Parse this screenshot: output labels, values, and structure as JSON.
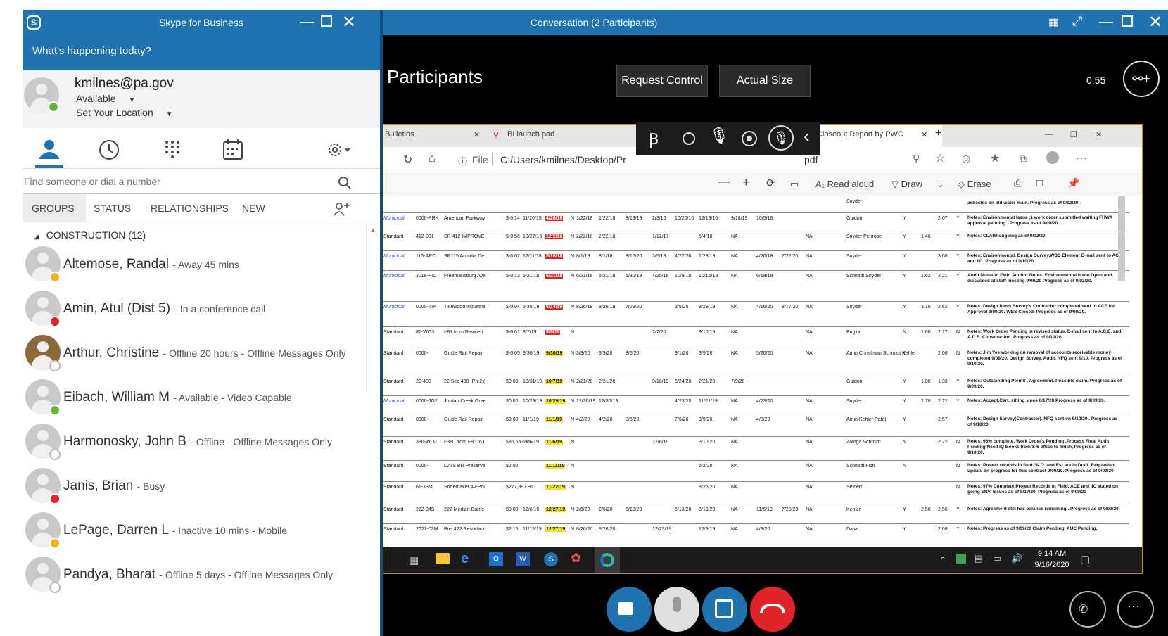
{
  "skype": {
    "title": "Skype for Business",
    "banner": "What's happening today?",
    "profile": {
      "email": "kmilnes@pa.gov",
      "status": "Available",
      "location": "Set Your Location"
    },
    "search_placeholder": "Find someone or dial a number",
    "tabs": [
      "GROUPS",
      "STATUS",
      "RELATIONSHIPS",
      "NEW"
    ],
    "group": {
      "label": "CONSTRUCTION (12)"
    },
    "contacts": [
      {
        "name": "Altemose, Randal",
        "note": "- Away 45 mins",
        "presence_color": "#f0b323"
      },
      {
        "name": "Amin, Atul (Dist 5)",
        "note": "- In a conference call",
        "presence_color": "#e0242a"
      },
      {
        "name": "Arthur, Christine",
        "note": "- Offline 20 hours - Offline Messages Only",
        "presence_color": "#ffffff"
      },
      {
        "name": "Eibach, William M",
        "note": "- Available - Video Capable",
        "presence_color": "#6bb33b"
      },
      {
        "name": "Harmonosky, John B",
        "note": "- Offline - Offline Messages Only",
        "presence_color": "#ffffff"
      },
      {
        "name": "Janis, Brian",
        "note": "- Busy",
        "presence_color": "#e0242a"
      },
      {
        "name": "LePage, Darren L",
        "note": "- Inactive 10 mins - Mobile",
        "presence_color": "#f0b323"
      },
      {
        "name": "Pandya, Bharat",
        "note": "- Offline 5 days - Offline Messages Only",
        "presence_color": "#ffffff"
      }
    ]
  },
  "conversation": {
    "title": "Conversation (2 Participants)",
    "participants_label": "Participants",
    "request_control": "Request Control",
    "actual_size": "Actual Size",
    "timer": "0:55"
  },
  "browser": {
    "tab1": "Bulletins",
    "tab2": "BI launch pad",
    "tab3": "Closeout Report by PWC",
    "file_label": "File",
    "url_start": "C:/Users/kmilnes/Desktop/Pr",
    "url_end": "pdf",
    "read_aloud": "Read aloud",
    "draw": "Draw",
    "erase": "Erase"
  },
  "pdf_rows": [
    {
      "type": "Municipal",
      "id": "0000-PRK",
      "name": "American Parkway",
      "amt": "$-0.14",
      "d1": "11/20/15",
      "flag": "4/26/16",
      "flag_color": "red",
      "n": "N",
      "c1": "1/22/18",
      "c2": "1/22/18",
      "c3": "8/13/19",
      "c4": "2/3/16",
      "c5": "10/20/16",
      "c6": "12/19/16",
      "c7": "9/18/19",
      "c8": "10/5/16",
      "c9": "",
      "c10": "",
      "person": "Guidon",
      "y1": "Y",
      "v1": "",
      "v2": "2.07",
      "y2": "Y",
      "note": "Notes: Environmental Issue ,1 work order submitted waiting FHWA approval pending . Progress as of 9/09/20."
    },
    {
      "type": "Standard",
      "id": "412-001",
      "name": "SR 412 IMPROVE",
      "amt": "$-0.56",
      "d1": "10/27/16",
      "flag": "12/2/16",
      "flag_color": "red",
      "n": "N",
      "c1": "2/22/18",
      "c2": "2/22/18",
      "c3": "",
      "c4": "1/12/17",
      "c5": "",
      "c6": "6/4/18",
      "c7": "NA",
      "c8": "",
      "c9": "",
      "c10": "NA",
      "person": "Snyder Penrose",
      "y1": "Y",
      "v1": "1.46",
      "v2": "",
      "y2": "Y",
      "note": "Notes: CLAIM ongoing as of 9/02/20."
    },
    {
      "type": "Municipal",
      "id": "115-ARC",
      "name": "SR115 Arcadia De",
      "amt": "$-0.07",
      "d1": "12/11/18",
      "flag": "5/18/18",
      "flag_color": "red",
      "n": "N",
      "c1": "8/1/18",
      "c2": "8/1/18",
      "c3": "8/16/20",
      "c4": "3/5/18",
      "c5": "4/22/20",
      "c6": "1/28/19",
      "c7": "NA",
      "c8": "4/20/18",
      "c9": "7/22/20",
      "c10": "NA",
      "person": "Snyder",
      "y1": "Y",
      "v1": "",
      "v2": "3.00",
      "y2": "Y",
      "note": "Notes: Environmental, Design Survey,WBS Element E-mail sent to ACE and IIC. Progress as of 9/10/20"
    },
    {
      "type": "Municipal",
      "id": "2018-FIC",
      "name": "Freemansburg Ave",
      "amt": "$-0.13",
      "d1": "6/21/18",
      "flag": "6/21/18",
      "flag_color": "red",
      "n": "N",
      "c1": "6/21/18",
      "c2": "6/21/18",
      "c3": "1/30/19",
      "c4": "4/25/18",
      "c5": "10/9/18",
      "c6": "10/16/18",
      "c7": "NA",
      "c8": "6/18/18",
      "c9": "",
      "c10": "NA",
      "person": "Schmidt Snyder",
      "y1": "Y",
      "v1": "1.62",
      "v2": "2.21",
      "y2": "Y",
      "note": "Audit Notes to Field Auditor Notes: Environmental Issue Open and discussed at staff meeting 9/09/20 Progress as of 9/02/20."
    },
    {
      "type": "Municipal",
      "id": "0000-TIP",
      "name": "Tidewood Industrie",
      "amt": "$-0.04",
      "d1": "5/30/19",
      "flag": "6/14/19",
      "flag_color": "red",
      "n": "N",
      "c1": "8/26/19",
      "c2": "8/26/19",
      "c3": "7/29/20",
      "c4": "",
      "c5": "3/5/20",
      "c6": "8/29/19",
      "c7": "NA",
      "c8": "4/16/20",
      "c9": "8/17/20",
      "c10": "NA",
      "person": "Snyder",
      "y1": "Y",
      "v1": "3.10",
      "v2": "2.62",
      "y2": "Y",
      "note": "Notes: Design Items Survey's Contractor completed sent to ACE for Approval 9/09/20. WBS Closed. Progress as of 9/09/20."
    },
    {
      "type": "Standard",
      "id": "81-WO3",
      "name": "I-81 from Ravine t",
      "amt": "$-0.01",
      "d1": "8/7/19",
      "flag": "8/9/19",
      "flag_color": "red",
      "n": "N",
      "c1": "",
      "c2": "",
      "c3": "",
      "c4": "2/7/20",
      "c5": "",
      "c6": "9/10/19",
      "c7": "NA",
      "c8": "",
      "c9": "",
      "c10": "NA",
      "person": "Puglia",
      "y1": "N",
      "v1": "1.60",
      "v2": "2.17",
      "y2": "N",
      "note": "Notes: Work Order Pending in revised status. E-mail sent to A.C.E. and A.D.E. Construction. Progress as of 9/10/20."
    },
    {
      "type": "Standard",
      "id": "0000-",
      "name": "Guide Rail Repair",
      "amt": "$-0.05",
      "d1": "9/30/19",
      "flag": "9/30/19",
      "flag_color": "yellow",
      "n": "N",
      "c1": "3/9/20",
      "c2": "3/9/20",
      "c3": "8/5/20",
      "c4": "",
      "c5": "9/1/20",
      "c6": "3/9/20",
      "c7": "NA",
      "c8": "5/20/20",
      "c9": "",
      "c10": "NA",
      "person": "Amin Christman Schmidt Kehler",
      "y1": "Y",
      "v1": "",
      "v2": "2.00",
      "y2": "N",
      "note": "Notes: Jim Yee working on removal of accounts receivable money completed 9/08/20. Design Survey, Audit. NFQ sent 9/10. Progress as of 9/10/20."
    },
    {
      "type": "Standard",
      "id": "22-400",
      "name": "22 Sec 400- Ph 2 (",
      "amt": "$0.00",
      "d1": "10/31/19",
      "flag": "10/7/19",
      "flag_color": "yellow",
      "n": "N",
      "c1": "2/21/20",
      "c2": "2/21/20",
      "c3": "",
      "c4": "9/18/19",
      "c5": "6/24/20",
      "c6": "2/21/20",
      "c7": "7/9/20",
      "c8": "",
      "c9": "",
      "c10": "",
      "person": "Guidon",
      "y1": "Y",
      "v1": "1.80",
      "v2": "1.33",
      "y2": "Y",
      "note": "Notes: Outstanding Permit , Agreement. Possible claim. Progress as of 9/09/20."
    },
    {
      "type": "Municipal",
      "id": "0000-JG2",
      "name": "Jordan Creek Gree",
      "amt": "$0.00",
      "d1": "10/29/19",
      "flag": "10/29/19",
      "flag_color": "yellow",
      "n": "N",
      "c1": "12/30/19",
      "c2": "12/30/19",
      "c3": "",
      "c4": "",
      "c5": "4/23/20",
      "c6": "11/21/19",
      "c7": "NA",
      "c8": "4/23/20",
      "c9": "",
      "c10": "NA",
      "person": "Snyder",
      "y1": "Y",
      "v1": "2.70",
      "v2": "2.22",
      "y2": "Y",
      "note": "Notes: Accept.Cert. sitting since 6/17/20.Progress as of 9/09/20."
    },
    {
      "type": "Standard",
      "id": "0000-",
      "name": "Guide Rail Repair",
      "amt": "$0.00",
      "d1": "11/1/19",
      "flag": "11/1/19",
      "flag_color": "yellow",
      "n": "N",
      "c1": "4/2/20",
      "c2": "4/2/20",
      "c3": "8/5/20",
      "c4": "",
      "c5": "7/6/20",
      "c6": "3/9/20",
      "c7": "NA",
      "c8": "4/8/20",
      "c9": "",
      "c10": "NA",
      "person": "Amin Kehler Patel",
      "y1": "Y",
      "v1": "",
      "v2": "2.57",
      "y2": "",
      "note": "Notes: Design Survey(Contractor). NFQ sent on 9/10/20 . Progress as of 9/10/20."
    },
    {
      "type": "Standard",
      "id": "380-WO2",
      "name": "I-380 from I-80 to I",
      "amt": "$86,663.60",
      "d1": "11/6/19",
      "flag": "11/6/19",
      "flag_color": "yellow",
      "n": "N",
      "c1": "",
      "c2": "",
      "c3": "",
      "c4": "12/6/19",
      "c5": "",
      "c6": "3/10/20",
      "c7": "NA",
      "c8": "",
      "c9": "",
      "c10": "NA",
      "person": "Zaloga Schmidt",
      "y1": "N",
      "v1": "",
      "v2": "2.22",
      "y2": "N",
      "note": "Notes: 96% complete, Work Order's Pending ,Process Final Audit Pending Need IQ Books from S-6 office to finish, Progress as of 9/10/20."
    },
    {
      "type": "Standard",
      "id": "0000-",
      "name": "LVTS BR Preserve",
      "amt": "$2.02",
      "d1": "",
      "flag": "11/11/19",
      "flag_color": "yellow",
      "n": "N",
      "c1": "",
      "c2": "",
      "c3": "",
      "c4": "",
      "c5": "",
      "c6": "6/2/20",
      "c7": "NA",
      "c8": "",
      "c9": "",
      "c10": "NA",
      "person": "Schmidt Fish",
      "y1": "N",
      "v1": "",
      "v2": "",
      "y2": "N",
      "note": "Notes: Project records in field. W.O. and Est are in Draft. Requested update on progress for this contract 9/09/20. Progress as of 9/09/20"
    },
    {
      "type": "Standard",
      "id": "61-13M",
      "name": "Shoemaker Av-Poi",
      "amt": "$277,897.91",
      "d1": "",
      "flag": "11/22/19",
      "flag_color": "yellow",
      "n": "N",
      "c1": "",
      "c2": "",
      "c3": "",
      "c4": "",
      "c5": "",
      "c6": "8/25/20",
      "c7": "NA",
      "c8": "",
      "c9": "",
      "c10": "NA",
      "person": "Seibert",
      "y1": "",
      "v1": "",
      "v2": "",
      "y2": "N",
      "note": "Notes: 97% Complete Project Records in Field. ACE and IIC stated on going ENV. Issues as of 8/17/20. Progress as of 9/09/20"
    },
    {
      "type": "Standard",
      "id": "222-04S",
      "name": "222 Median Barrie",
      "amt": "$0.00",
      "d1": "12/6/19",
      "flag": "12/27/19",
      "flag_color": "yellow",
      "n": "N",
      "c1": "2/6/20",
      "c2": "2/6/20",
      "c3": "5/18/20",
      "c4": "",
      "c5": "6/13/20",
      "c6": "6/19/20",
      "c7": "NA",
      "c8": "11/6/19",
      "c9": "7/20/20",
      "c10": "NA",
      "person": "Kehler",
      "y1": "Y",
      "v1": "2.50",
      "v2": "2.50",
      "y2": "Y",
      "note": "Notes: Agreement still has balance remaining.. Progress as of 9/09/20."
    },
    {
      "type": "Standard",
      "id": "2021-03M",
      "name": "Bus 422 Resurfacc",
      "amt": "$2.15",
      "d1": "11/15/19",
      "flag": "12/27/19",
      "flag_color": "yellow",
      "n": "N",
      "c1": "8/26/20",
      "c2": "8/26/20",
      "c3": "",
      "c4": "12/23/19",
      "c5": "",
      "c6": "12/9/19",
      "c7": "NA",
      "c8": "4/9/20",
      "c9": "",
      "c10": "NA",
      "person": "Dalia",
      "y1": "Y",
      "v1": "",
      "v2": "2.08",
      "y2": "Y",
      "note": "Notes: Progress as of 9/09/20 Claim Pending. AUC Pending."
    }
  ],
  "pdf_top_fragment": {
    "person": "Snyder",
    "note": "asbestos on old water main. Progress as of 9/02/20."
  },
  "taskbar": {
    "time": "9:14 AM",
    "date": "9/16/2020"
  }
}
